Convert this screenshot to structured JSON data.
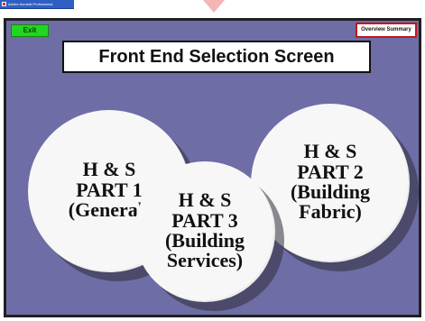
{
  "window": {
    "title": "Adobe Acrobat Professional"
  },
  "controls": {
    "exit_label": "Exit",
    "overview_label": "Overview Summary"
  },
  "slide": {
    "title": "Front End Selection Screen"
  },
  "options": [
    {
      "line1": "H & S",
      "line2": "PART 1",
      "line3": "(General)"
    },
    {
      "line1": "H & S",
      "line2": "PART 2",
      "line3": "(Building",
      "line4": "Fabric)"
    },
    {
      "line1": "H & S",
      "line2": "PART 3",
      "line3": "(Building",
      "line4": "Services)"
    }
  ],
  "colors": {
    "slide_background": "#6f6da6",
    "exit_button": "#22d61f",
    "overview_border": "#c4161c",
    "title_box": "#ffffff",
    "circle_fill": "#f7f7f7"
  },
  "icons": {
    "app_icon": "app-icon"
  }
}
